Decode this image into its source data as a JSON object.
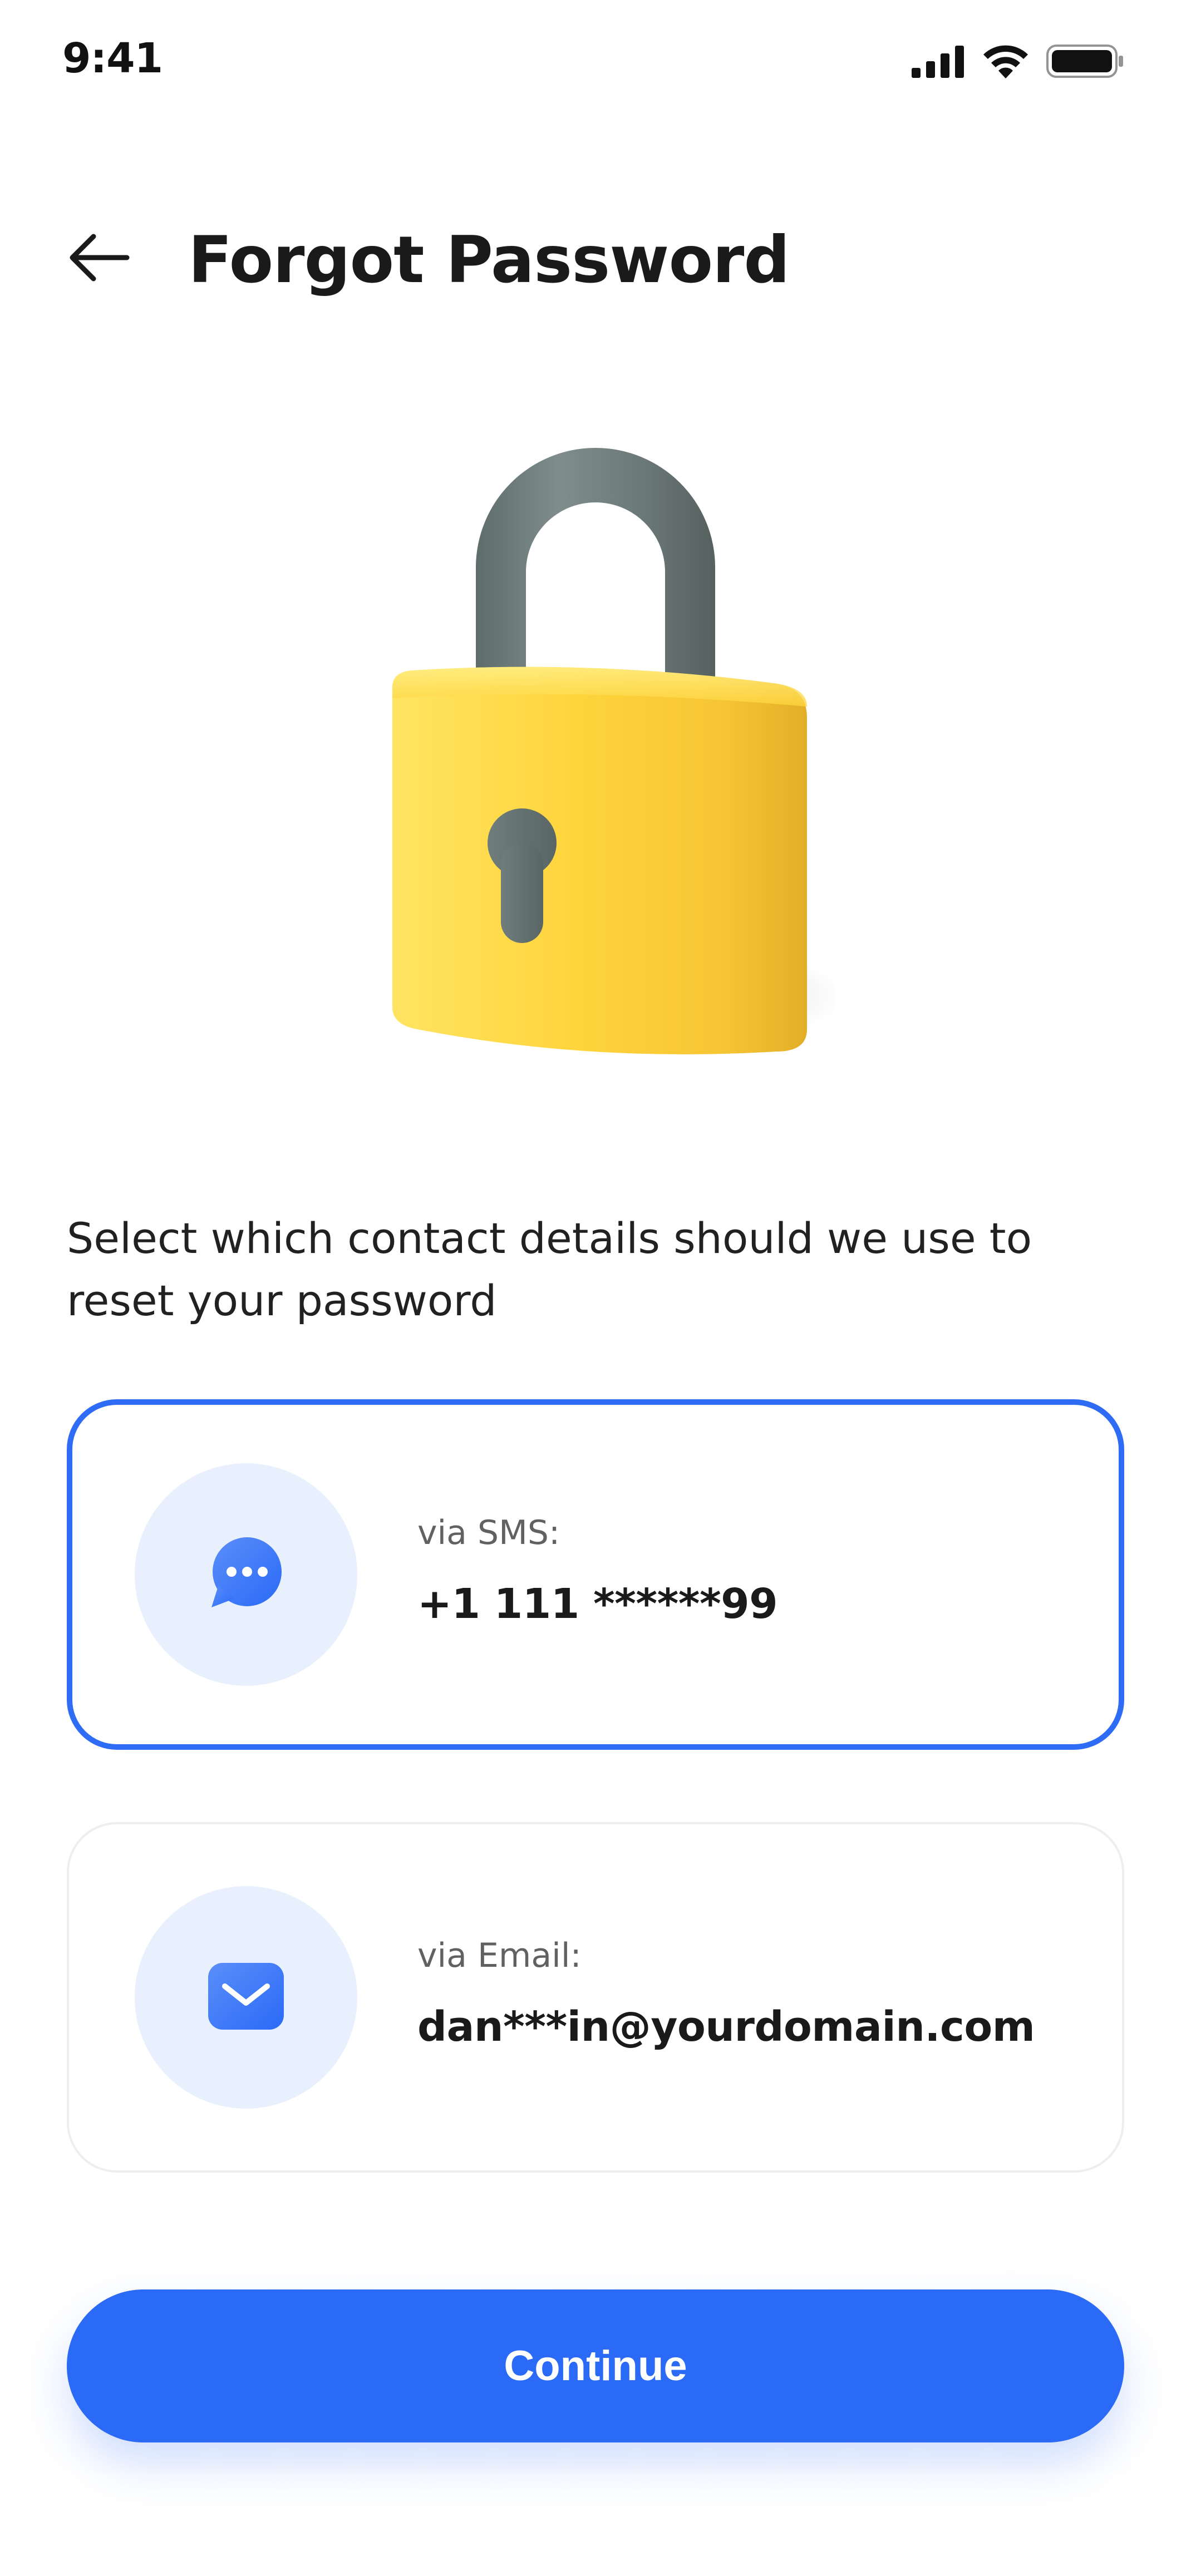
{
  "status_bar": {
    "time": "9:41",
    "icons": [
      "signal-icon",
      "wifi-icon",
      "battery-icon"
    ]
  },
  "header": {
    "title": "Forgot Password",
    "back_icon": "arrow-left-icon"
  },
  "illustration": {
    "icon": "padlock-icon"
  },
  "description": "Select which contact details should we use to reset your password",
  "options": [
    {
      "label": "via SMS:",
      "value": "+1 111 ******99",
      "icon": "chat-bubble-icon",
      "selected": true
    },
    {
      "label": "via Email:",
      "value": "dan***in@yourdomain.com",
      "icon": "mail-icon",
      "selected": false
    }
  ],
  "continue_label": "Continue",
  "colors": {
    "accent": "#2A6AF7",
    "accent_light": "#E8F0FE",
    "lock_body": "#FFD43B",
    "lock_shackle": "#6B7878",
    "text_primary": "#1A1A1A",
    "text_secondary": "#616161"
  }
}
